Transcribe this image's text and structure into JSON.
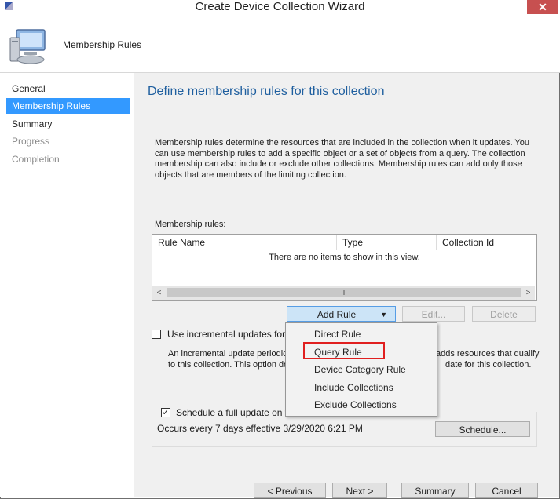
{
  "window": {
    "title": "Create Device Collection Wizard",
    "close_glyph": "✕"
  },
  "header": {
    "title": "Membership Rules",
    "icon": "computer-icon"
  },
  "sidebar": {
    "items": [
      {
        "label": "General",
        "state": "normal"
      },
      {
        "label": "Membership Rules",
        "state": "active"
      },
      {
        "label": "Summary",
        "state": "normal"
      },
      {
        "label": "Progress",
        "state": "disabled"
      },
      {
        "label": "Completion",
        "state": "disabled"
      }
    ]
  },
  "main": {
    "page_title": "Define membership rules for this collection",
    "description": "Membership rules determine the resources that are included in the collection when it updates. You can use membership rules to add a specific object or a set of objects from a query. The collection membership can also include or exclude other collections. Membership rules can add only those objects that are members of the limiting collection.",
    "rules_label": "Membership rules:",
    "columns": [
      "Rule Name",
      "Type",
      "Collection Id"
    ],
    "empty_text": "There are no items to show in this view.",
    "scroll_thumb": "III",
    "buttons": {
      "add_rule": "Add Rule",
      "edit": "Edit...",
      "delete": "Delete",
      "schedule": "Schedule..."
    },
    "incremental": {
      "label": "Use incremental updates for thi",
      "checked": false,
      "desc_left_1": "An incremental update periodic",
      "desc_left_2": "to this collection. This option do",
      "desc_right_1": "adds resources that qualify",
      "desc_right_2": "date for this collection."
    },
    "full_update": {
      "label": "Schedule a full update on this collection",
      "checked": true,
      "check_glyph": "✓",
      "schedule_text": "Occurs every 7 days effective 3/29/2020 6:21 PM"
    }
  },
  "add_rule_menu": {
    "items": [
      "Direct Rule",
      "Query Rule",
      "Device Category Rule",
      "Include Collections",
      "Exclude Collections"
    ],
    "highlighted": "Query Rule",
    "highlight_color": "#e01f1f"
  },
  "footer": {
    "previous": "< Previous",
    "next": "Next >",
    "summary": "Summary",
    "cancel": "Cancel"
  },
  "colors": {
    "accent": "#3399ff",
    "title_blue": "#1f5f9f",
    "close_red": "#c75050"
  }
}
